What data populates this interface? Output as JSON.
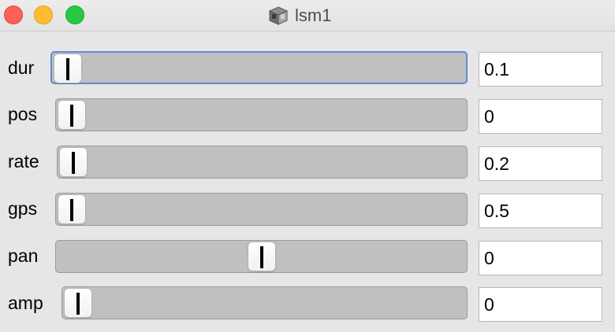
{
  "window": {
    "title": "lsm1",
    "icon": "cube-app-icon"
  },
  "controls": [
    {
      "label": "dur",
      "value": "0.1",
      "level": 0.0
    },
    {
      "label": "pos",
      "value": "0",
      "level": 0.0
    },
    {
      "label": "rate",
      "value": "0.2",
      "level": 0.0
    },
    {
      "label": "gps",
      "value": "0.5",
      "level": 0.0
    },
    {
      "label": "pan",
      "value": "0",
      "level": 0.5
    },
    {
      "label": "amp",
      "value": "0",
      "level": 0.0
    }
  ],
  "colors": {
    "close": "#fe5f57",
    "minimize": "#febc2e",
    "zoom": "#28c840",
    "focus_ring": "#5b8bd6",
    "track": "#c0c0c0"
  }
}
